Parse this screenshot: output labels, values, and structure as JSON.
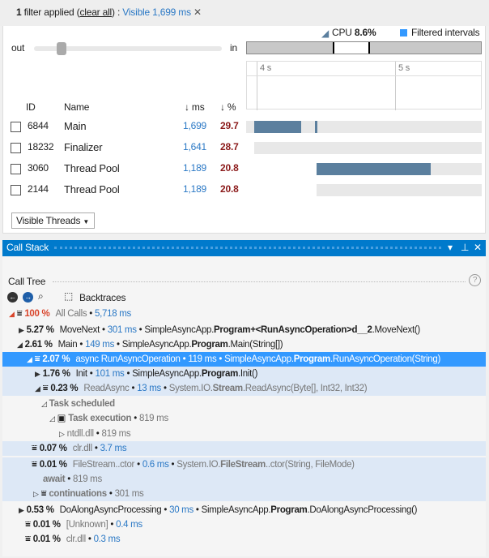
{
  "filter": {
    "count": "1",
    "text": " filter applied (",
    "clear": "clear all",
    "after": ") :",
    "visible": "Visible 1,699 ms"
  },
  "zoom": {
    "out": "out",
    "in": "in"
  },
  "legend": {
    "cpu_label": "CPU",
    "cpu_value": "8.6%",
    "filtered": "Filtered intervals"
  },
  "ruler": {
    "ticks": [
      "4 s",
      "5 s"
    ]
  },
  "threads": {
    "headers": {
      "id": "ID",
      "name": "Name",
      "ms": "↓ ms",
      "pct": "↓ %"
    },
    "rows": [
      {
        "id": "6844",
        "name": "Main",
        "ms": "1,699",
        "pct": "29.7"
      },
      {
        "id": "18232",
        "name": "Finalizer",
        "ms": "1,641",
        "pct": "28.7"
      },
      {
        "id": "3060",
        "name": "Thread Pool",
        "ms": "1,189",
        "pct": "20.8"
      },
      {
        "id": "2144",
        "name": "Thread Pool",
        "ms": "1,189",
        "pct": "20.8"
      }
    ],
    "dropdown": "Visible Threads"
  },
  "callstack": {
    "title": "Call Stack",
    "section": "Call Tree",
    "backtraces": "Backtraces",
    "rows": [
      {
        "ind": 8,
        "exp": "◢",
        "expc": "#d9452b",
        "f": 1,
        "pct": "100 %",
        "pctc": "#d9452b",
        "name": "All Calls",
        "nc": "g",
        "ms": "5,718 ms"
      },
      {
        "ind": 20,
        "exp": "▶",
        "f": 0,
        "pct": "5.27 %",
        "name": "MoveNext",
        "ms": "301 ms",
        "fq": [
          "SimpleAsyncApp.",
          "Program+<RunAsyncOperation>d__2",
          ".MoveNext()"
        ]
      },
      {
        "ind": 18,
        "exp": "◢",
        "f": 0,
        "pct": "2.61 %",
        "name": "Main",
        "ms": "149 ms",
        "fq": [
          "SimpleAsyncApp.",
          "Program",
          ".Main(String[])"
        ]
      },
      {
        "ind": 30,
        "exp": "◢",
        "f": 1,
        "pct": "2.07 %",
        "name": "async RunAsyncOperation",
        "ms": "119 ms",
        "fq": [
          "SimpleAsyncApp.",
          "Program",
          ".RunAsyncOperation(String)"
        ],
        "cls": "sel"
      },
      {
        "ind": 40,
        "exp": "▶",
        "f": 0,
        "pct": "1.76 %",
        "name": "Init",
        "ms": "101 ms",
        "fq": [
          "SimpleAsyncApp.",
          "Program",
          ".Init()"
        ],
        "cls": "hl"
      },
      {
        "ind": 40,
        "exp": "◢",
        "f": 1,
        "pct": "0.23 %",
        "name": "ReadAsync",
        "nc": "g",
        "ms": "13 ms",
        "fq": [
          "System.IO.",
          "Stream",
          ".ReadAsync(Byte[], Int32, Int32)"
        ],
        "fqc": "g",
        "cls": "hl"
      },
      {
        "ind": 48,
        "exp": "◿",
        "f": 0,
        "label": "Task scheduled"
      },
      {
        "ind": 58,
        "exp": "◿",
        "f": 0,
        "task": 1,
        "label": "Task execution",
        "ms2": "819 ms"
      },
      {
        "ind": 70,
        "exp": "▷",
        "f": 0,
        "name": "ntdll.dll",
        "nc": "g",
        "ms2": "819 ms"
      },
      {
        "ind": 36,
        "exp": "",
        "f": 1,
        "pct": "0.07 %",
        "name": "clr.dll",
        "nc": "g",
        "ms": "3.7 ms",
        "cls": "hl"
      },
      {
        "ind": 36,
        "exp": "",
        "f": 1,
        "pct": "0.01 %",
        "name": "FileStream..ctor",
        "nc": "g",
        "ms": "0.6 ms",
        "fq": [
          "System.IO.",
          "FileStream",
          "..ctor(String, FileMode)"
        ],
        "fqc": "g",
        "cls": "hl"
      },
      {
        "ind": 50,
        "exp": "",
        "f": 0,
        "label": "await",
        "ms2": "819 ms",
        "cls": "hl"
      },
      {
        "ind": 38,
        "exp": "▷",
        "f": 1,
        "label": "continuations",
        "ms2": "301 ms",
        "cls": "hl"
      },
      {
        "ind": 20,
        "exp": "▶",
        "f": 0,
        "pct": "0.53 %",
        "name": "DoAlongAsyncProcessing",
        "ms": "30 ms",
        "fq": [
          "SimpleAsyncApp.",
          "Program",
          ".DoAlongAsyncProcessing()"
        ]
      },
      {
        "ind": 28,
        "exp": "",
        "f": 1,
        "pct": "0.01 %",
        "name": "[Unknown]",
        "nc": "g",
        "ms": "0.4 ms"
      },
      {
        "ind": 28,
        "exp": "",
        "f": 1,
        "pct": "0.01 %",
        "name": "clr.dll",
        "nc": "g",
        "ms": "0.3 ms"
      }
    ]
  },
  "colors": {
    "accent": "#007acc",
    "selected": "#3399ff",
    "cpu_bar": "#5b7f9e",
    "filtered": "#3399ff"
  }
}
